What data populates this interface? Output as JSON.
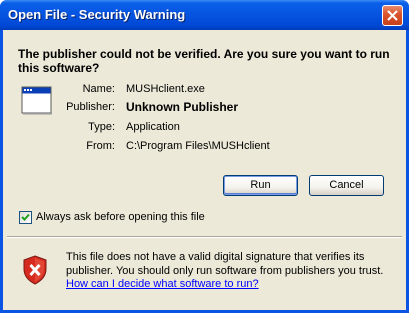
{
  "window": {
    "title": "Open File - Security Warning",
    "close_icon": "close-icon"
  },
  "dialog": {
    "heading": "The publisher could not be verified.  Are you sure you want to run this software?",
    "app_icon": "application-window-icon",
    "properties": [
      {
        "label": "Name:",
        "value": "MUSHclient.exe",
        "bold": false
      },
      {
        "label": "Publisher:",
        "value": "Unknown Publisher",
        "bold": true
      },
      {
        "label": "Type:",
        "value": "Application",
        "bold": false
      },
      {
        "label": "From:",
        "value": "C:\\Program Files\\MUSHclient",
        "bold": false
      }
    ],
    "buttons": {
      "run_label": "Run",
      "cancel_label": "Cancel"
    },
    "checkbox": {
      "label": "Always ask before opening this file",
      "checked": true
    },
    "warning": {
      "icon": "security-shield-icon",
      "text": "This file does not have a valid digital signature that verifies its publisher.  You should only run software from publishers you trust.",
      "link_text": "How can I decide what software to run?"
    }
  },
  "colors": {
    "titlebar": "#0054e3",
    "dialog_background": "#ece9d8",
    "link": "#0000ff",
    "shield_red": "#d62a1e"
  }
}
